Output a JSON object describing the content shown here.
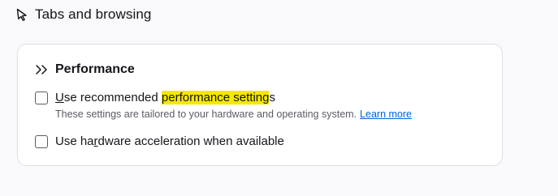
{
  "section": {
    "title": "Tabs and browsing",
    "icon": "pointer-icon"
  },
  "performance": {
    "title": "Performance",
    "icon": "double-chevron-right-icon",
    "options": [
      {
        "label_prefix_accesskey": "U",
        "label_before_highlight": "se recommended ",
        "label_highlight": "performance setting",
        "label_after_highlight": "s",
        "checked": false,
        "description": "These settings are tailored to your hardware and operating system.",
        "link_text": "Learn more"
      },
      {
        "label_before_accesskey": "Use ha",
        "label_accesskey": "r",
        "label_after_accesskey": "dware acceleration when available",
        "checked": false
      }
    ]
  },
  "colors": {
    "highlight": "#f5e800",
    "link": "#0061e0",
    "card_border": "#e0e0e6",
    "background": "#f9f9fb"
  }
}
